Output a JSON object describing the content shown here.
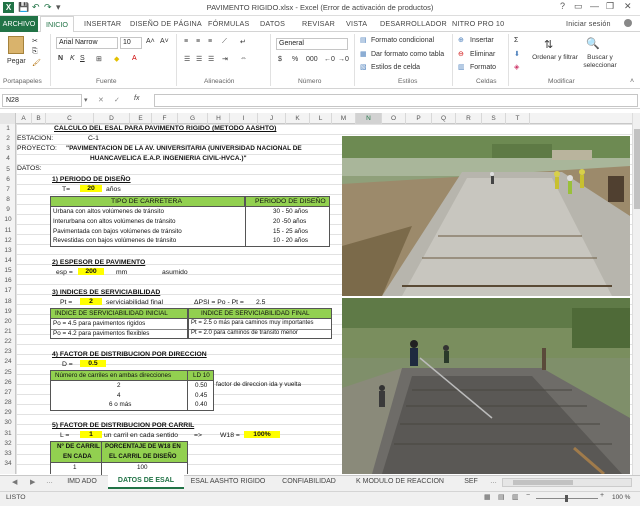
{
  "window": {
    "title": "PAVIMENTO RIGIDO.xlsx - Excel (Error de activación de productos)",
    "signin": "Iniciar sesión"
  },
  "tabs": {
    "file": "ARCHIVO",
    "items": [
      "INICIO",
      "INSERTAR",
      "DISEÑO DE PÁGINA",
      "FÓRMULAS",
      "DATOS",
      "REVISAR",
      "VISTA",
      "DESARROLLADOR",
      "NITRO PRO 10"
    ]
  },
  "ribbon": {
    "paste": "Pegar",
    "clipboard": "Portapapeles",
    "font_name": "Arial Narrow",
    "font_size": "10",
    "font": "Fuente",
    "alignment": "Alineación",
    "number_format": "General",
    "number": "Número",
    "cond_format": "Formato condicional",
    "table_format": "Dar formato como tabla",
    "cell_styles": "Estilos de celda",
    "styles": "Estilos",
    "insert": "Insertar",
    "delete": "Eliminar",
    "format": "Formato",
    "cells": "Celdas",
    "sort": "Ordenar y filtrar",
    "find": "Buscar y seleccionar",
    "modify": "Modificar"
  },
  "formula_bar": {
    "name_box": "N28",
    "fx": "fx",
    "value": ""
  },
  "columns": [
    "A",
    "B",
    "C",
    "D",
    "E",
    "F",
    "G",
    "H",
    "I",
    "J",
    "K",
    "L",
    "M",
    "N",
    "O",
    "P",
    "Q",
    "R",
    "S",
    "T"
  ],
  "rows": [
    "1",
    "2",
    "3",
    "4",
    "5",
    "6",
    "7",
    "8",
    "9",
    "10",
    "11",
    "12",
    "13",
    "14",
    "15",
    "16",
    "17",
    "18",
    "19",
    "20",
    "21",
    "22",
    "23",
    "24",
    "25",
    "26",
    "27",
    "28",
    "29",
    "30",
    "31",
    "32",
    "33",
    "34"
  ],
  "sheet": {
    "title": "CALCULO DEL ESAL PARA PAVIMENTO RIGIDO (METODO AASHTO)",
    "estacion_label": "ESTACION:",
    "estacion_value": "C-1",
    "proyecto_label": "PROYECTO:",
    "proyecto_l1": "\"PAVIMENTACION DE LA AV. UNIVERSITARIA (UNIVERSIDAD NACIONAL DE",
    "proyecto_l2": "HUANCAVELICA E.A.P. INGENIERIA CIVIL-HVCA.)\"",
    "datos_label": "DATOS:",
    "s1_title": "1) PERIODO DE DISEÑO",
    "t_label": "T=",
    "t_value": "20",
    "t_unit": "años",
    "s1_table": {
      "h1": "TIPO DE CARRETERA",
      "h2": "PERIODO DE DISEÑO",
      "rows": [
        [
          "Urbana con altos volúmenes de tránsito",
          "30 - 50 años"
        ],
        [
          "Interurbana con altos volúmenes de tránsito",
          "20 -50 años"
        ],
        [
          "Pavimentada con bajos volúmenes de tránsito",
          "15 - 25 años"
        ],
        [
          "Revestidas con bajos volúmenes de tránsito",
          "10 - 20 años"
        ]
      ]
    },
    "s2_title": "2) ESPESOR DE PAVIMENTO",
    "esp_label": "esp =",
    "esp_value": "200",
    "esp_unit": "mm",
    "esp_note": "asumido",
    "s3_title": "3) INDICES DE SERVICIABILIDAD",
    "pt_label": "Pt =",
    "pt_value": "2",
    "pt_note": "serviciabilidad final",
    "dpsi": "ΔPSI = Po - Pt =",
    "dpsi_value": "2.5",
    "s3_table_a": {
      "h": "INDICE DE SERVICIABILIDAD INICIAL",
      "rows": [
        "Po = 4.5 para pavimentos rigidos",
        "Po = 4.2 para pavimentos flexibles"
      ]
    },
    "s3_table_b": {
      "h": "INDICE DE SERVICIABILIDAD FINAL",
      "rows": [
        "Pt = 2.5 o más para caminos muy importantes",
        "Pt = 2.0 para caminos de transito menor"
      ]
    },
    "s4_title": "4) FACTOR DE DISTRIBUCION POR DIRECCION",
    "d_label": "D =",
    "d_value": "0.5",
    "s4_table": {
      "h1": "Número de carriles en ambas direcciones",
      "h2": "LD 10",
      "rows": [
        [
          "2",
          "0.50"
        ],
        [
          "4",
          "0.45"
        ],
        [
          "6 o más",
          "0.40"
        ]
      ]
    },
    "s4_note": "factor de direccion ida y vuelta",
    "s5_title": "5) FACTOR DE DISTRIBUCION POR CARRIL",
    "l_label": "L =",
    "l_value": "1",
    "l_note": "un carril en cada sentido",
    "arrow": "=>",
    "w18_label": "W18 =",
    "w18_value": "100%",
    "s5_table": {
      "h1a": "Nº DE CARRIL",
      "h1b": "EN CADA",
      "h2a": "PORCENTAJE DE W18 EN",
      "h2b": "EL CARRIL DE DISEÑO",
      "rows": [
        [
          "1",
          "100"
        ]
      ]
    }
  },
  "sheet_tabs": [
    "IMD ADO",
    "DATOS DE ESAL",
    "ESAL AASHTO RIGIDO",
    "CONFIABILIDAD",
    "K MODULO DE REACCION",
    "SEF"
  ],
  "active_sheet": "DATOS DE ESAL",
  "status": {
    "ready": "LISTO",
    "zoom": "100 %"
  },
  "colors": {
    "excel_green": "#217346",
    "highlight_yellow": "#ffff00",
    "header_green": "#92d050"
  }
}
